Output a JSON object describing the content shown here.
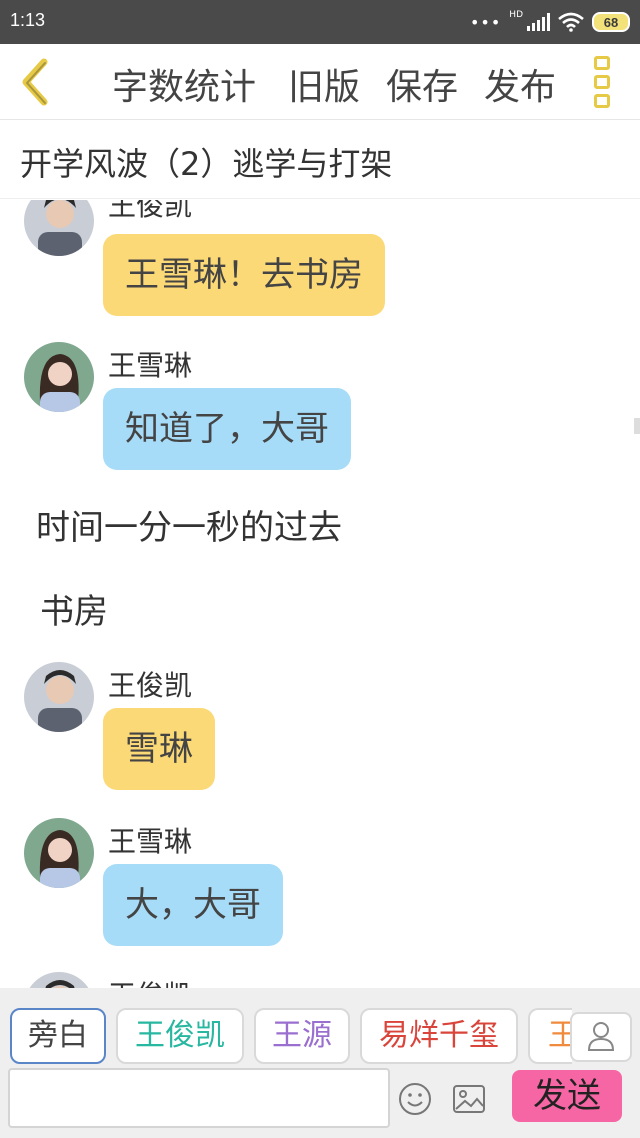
{
  "status_bar": {
    "time": "1:13",
    "network": "HD",
    "battery": "68"
  },
  "toolbar": {
    "word_count_label": "字数统计",
    "old_version_label": "旧版",
    "save_label": "保存",
    "publish_label": "发布"
  },
  "chapter": {
    "title": "开学风波（2）逃学与打架"
  },
  "messages": [
    {
      "speaker": "王俊凯",
      "text": "王雪琳！去书房"
    },
    {
      "speaker": "王雪琳",
      "text": "知道了，大哥"
    },
    {
      "narration": "时间一分一秒的过去"
    },
    {
      "narration": "书房"
    },
    {
      "speaker": "王俊凯",
      "text": "雪琳"
    },
    {
      "speaker": "王雪琳",
      "text": "大，大哥"
    },
    {
      "speaker": "王俊凯"
    }
  ],
  "roles": [
    {
      "label": "旁白",
      "color": "#444444"
    },
    {
      "label": "王俊凯",
      "color": "#28b7a0"
    },
    {
      "label": "王源",
      "color": "#9a6fd0"
    },
    {
      "label": "易烊千玺",
      "color": "#d9453b"
    },
    {
      "label": "王",
      "color": "#f08a3c"
    }
  ],
  "composer": {
    "input_value": "",
    "send_label": "发送"
  },
  "colors": {
    "yellow_bubble": "#fcd977",
    "blue_bubble": "#a7dcf8",
    "send_button": "#f766a4",
    "accent": "#e6c945"
  }
}
